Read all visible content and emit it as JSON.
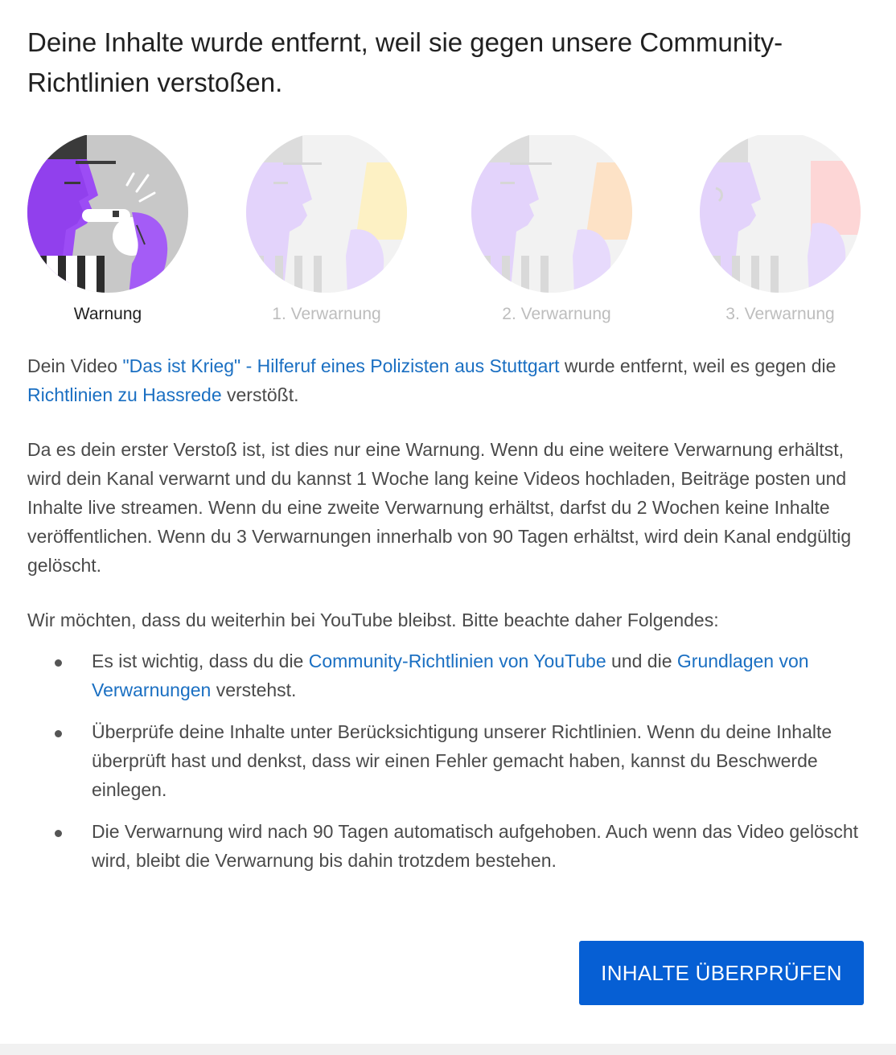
{
  "dialog": {
    "title": "Deine Inhalte wurde entfernt, weil sie gegen unsere Community-Richtlinien verstoßen."
  },
  "stages": [
    {
      "label": "Warnung",
      "active": true,
      "card_color": "#ffffff"
    },
    {
      "label": "1. Verwarnung",
      "active": false,
      "card_color": "#fdf1c4"
    },
    {
      "label": "2. Verwarnung",
      "active": false,
      "card_color": "#fde2c6"
    },
    {
      "label": "3. Verwarnung",
      "active": false,
      "card_color": "#fdd6d6"
    }
  ],
  "removal_notice": {
    "prefix": "Dein Video ",
    "video_link": "\"Das ist Krieg\" - Hilferuf eines Polizisten aus Stuttgart",
    "middle": " wurde entfernt, weil es gegen die ",
    "policy_link": "Richtlinien zu Hassrede",
    "suffix": " verstößt."
  },
  "warning_explanation": "Da es dein erster Verstoß ist, ist dies nur eine Warnung. Wenn du eine weitere Verwarnung erhältst, wird dein Kanal verwarnt und du kannst 1 Woche lang keine Videos hochladen, Beiträge posten und Inhalte live streamen. Wenn du eine zweite Verwarnung erhältst, darfst du 2 Wochen keine Inhalte veröffentlichen. Wenn du 3 Verwarnungen innerhalb von 90 Tagen erhältst, wird dein Kanal endgültig gelöscht.",
  "intro": "Wir möchten, dass du weiterhin bei YouTube bleibst. Bitte beachte daher Folgendes:",
  "bullets": {
    "b1": {
      "prefix": "Es ist wichtig, dass du die ",
      "link1": "Community-Richtlinien von YouTube",
      "middle": " und die ",
      "link2": "Grundlagen von Verwarnungen",
      "suffix": " verstehst."
    },
    "b2": "Überprüfe deine Inhalte unter Berücksichtigung unserer Richtlinien. Wenn du deine Inhalte überprüft hast und denkst, dass wir einen Fehler gemacht haben, kannst du Beschwerde einlegen.",
    "b3": "Die Verwarnung wird nach 90 Tagen automatisch aufgehoben. Auch wenn das Video gelöscht wird, bleibt die Verwarnung bis dahin trotzdem bestehen."
  },
  "actions": {
    "review_button": "INHALTE ÜBERPRÜFEN"
  },
  "colors": {
    "link": "#1a6fc2",
    "button": "#065fd4",
    "accent_purple": "#9c4cf5"
  }
}
